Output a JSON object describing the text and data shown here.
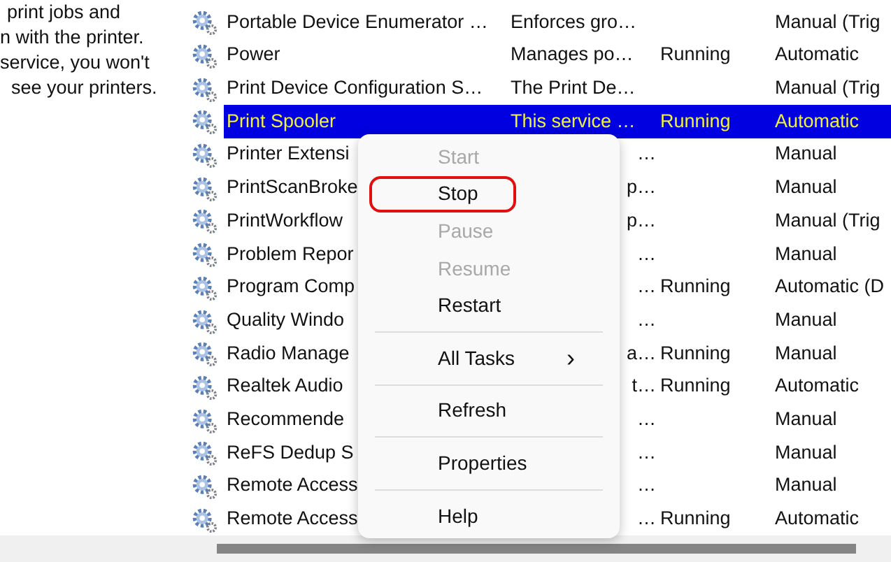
{
  "description": {
    "lines": [
      "print jobs and",
      "n with the printer.",
      "service, you won't",
      "see your printers."
    ]
  },
  "services": [
    {
      "name": "Portable Device Enumerator …",
      "description": "Enforces gro…",
      "startup": "Manual (Trig",
      "selected": false,
      "covered": false
    },
    {
      "name": "Power",
      "description": "Manages po…",
      "status": "Running",
      "startup": "Automatic",
      "selected": false,
      "covered": false
    },
    {
      "name": "Print Device Configuration S…",
      "description": "The Print De…",
      "startup": "Manual (Trig",
      "selected": false,
      "covered": false
    },
    {
      "name": "Print Spooler",
      "description": "This service …",
      "status": "Running",
      "startup": "Automatic",
      "selected": true,
      "covered": false
    },
    {
      "name": "Printer Extensi",
      "description": "…",
      "startup": "Manual",
      "selected": false,
      "covered": true
    },
    {
      "name": "PrintScanBroke",
      "description": "p…",
      "startup": "Manual",
      "selected": false,
      "covered": true
    },
    {
      "name": "PrintWorkflow",
      "description": "p…",
      "startup": "Manual (Trig",
      "selected": false,
      "covered": true
    },
    {
      "name": "Problem Repor",
      "description": "…",
      "startup": "Manual",
      "selected": false,
      "covered": true
    },
    {
      "name": "Program Comp",
      "description": "…",
      "status": "Running",
      "startup": "Automatic (D",
      "selected": false,
      "covered": true
    },
    {
      "name": "Quality Windo",
      "description": "…",
      "startup": "Manual",
      "selected": false,
      "covered": true
    },
    {
      "name": "Radio Manage",
      "description": "a…",
      "status": "Running",
      "startup": "Manual",
      "selected": false,
      "covered": true
    },
    {
      "name": "Realtek Audio",
      "description": "t…",
      "status": "Running",
      "startup": "Automatic",
      "selected": false,
      "covered": true
    },
    {
      "name": "Recommende",
      "description": "…",
      "startup": "Manual",
      "selected": false,
      "covered": true
    },
    {
      "name": "ReFS Dedup S",
      "description": "…",
      "startup": "Manual",
      "selected": false,
      "covered": true
    },
    {
      "name": "Remote Access",
      "description": "…",
      "startup": "Manual",
      "selected": false,
      "covered": true
    },
    {
      "name": "Remote Access",
      "description": "…",
      "status": "Running",
      "startup": "Automatic",
      "selected": false,
      "covered": true
    }
  ],
  "context_menu": {
    "items": [
      {
        "kind": "item",
        "label": "Start",
        "disabled": true,
        "highlighted": false
      },
      {
        "kind": "item",
        "label": "Stop",
        "disabled": false,
        "highlighted": true
      },
      {
        "kind": "item",
        "label": "Pause",
        "disabled": true,
        "highlighted": false
      },
      {
        "kind": "item",
        "label": "Resume",
        "disabled": true,
        "highlighted": false
      },
      {
        "kind": "item",
        "label": "Restart",
        "disabled": false,
        "highlighted": false
      },
      {
        "kind": "separator"
      },
      {
        "kind": "item",
        "label": "All Tasks",
        "arrow": "›",
        "disabled": false,
        "highlighted": false
      },
      {
        "kind": "separator"
      },
      {
        "kind": "item",
        "label": "Refresh",
        "disabled": false,
        "highlighted": false
      },
      {
        "kind": "separator"
      },
      {
        "kind": "item",
        "label": "Properties",
        "disabled": false,
        "highlighted": false
      },
      {
        "kind": "separator"
      },
      {
        "kind": "item",
        "label": "Help",
        "disabled": false,
        "highlighted": false
      }
    ]
  }
}
